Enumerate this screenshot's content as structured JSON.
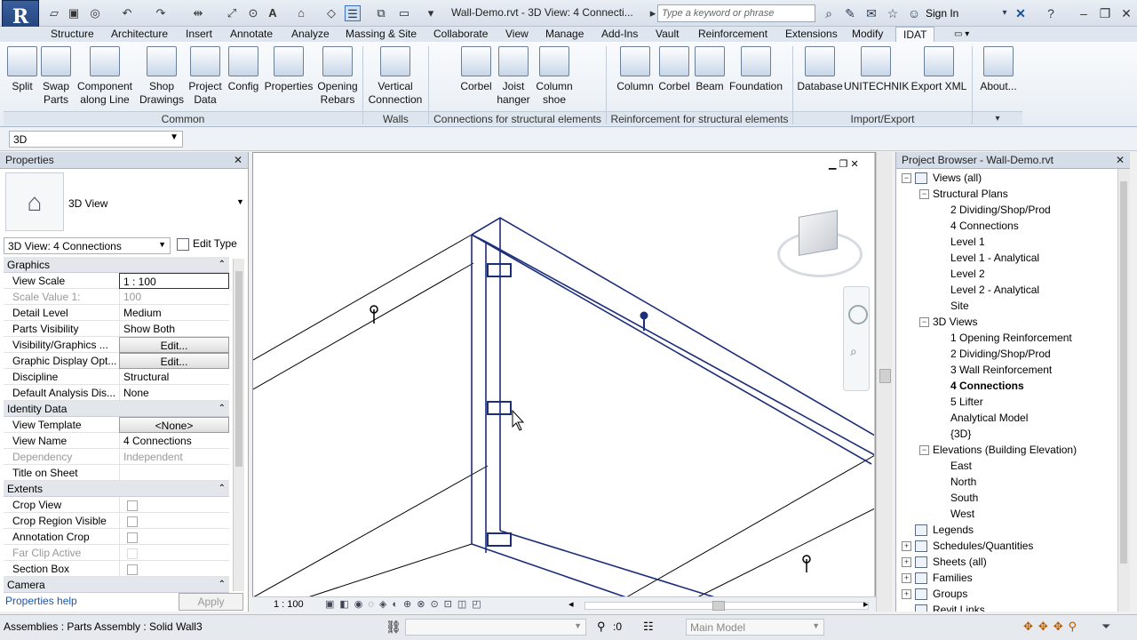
{
  "titlebar": {
    "app_logo": "R",
    "document_title": "Wall-Demo.rvt - 3D View: 4 Connecti...",
    "search_placeholder": "Type a keyword or phrase",
    "sign_in": "Sign In"
  },
  "ribbon": {
    "tabs": [
      "Structure",
      "Architecture",
      "Insert",
      "Annotate",
      "Analyze",
      "Massing & Site",
      "Collaborate",
      "View",
      "Manage",
      "Add-Ins",
      "Vault",
      "Reinforcement",
      "Extensions",
      "Modify",
      "IDAT"
    ],
    "active_tab": "IDAT",
    "buttons": {
      "split": "Split",
      "swap_parts": "Swap Parts",
      "component_along_line": "Component along Line",
      "shop_drawings": "Shop Drawings",
      "project_data": "Project Data",
      "config": "Config",
      "properties": "Properties",
      "opening_rebars": "Opening Rebars",
      "vertical_connection": "Vertical Connection",
      "corbel": "Corbel",
      "joist_hanger": "Joist hanger",
      "column_shoe": "Column shoe",
      "column": "Column",
      "corbel2": "Corbel",
      "beam": "Beam",
      "foundation": "Foundation",
      "database": "Database",
      "unitechnik": "UNITECHNIK",
      "export_xml": "Export XML",
      "about": "About..."
    },
    "panels": {
      "common": "Common",
      "walls": "Walls",
      "connections": "Connections for structural elements",
      "reinforcement": "Reinforcement for structural elements",
      "import_export": "Import/Export"
    }
  },
  "typebar": {
    "value": "3D"
  },
  "properties": {
    "title": "Properties",
    "type_name": "3D View",
    "instance_selector": "3D View: 4 Connections",
    "edit_type": "Edit Type",
    "groups": {
      "graphics": "Graphics",
      "identity": "Identity Data",
      "extents": "Extents",
      "camera": "Camera"
    },
    "rows": {
      "view_scale_k": "View Scale",
      "view_scale_v": "1 : 100",
      "scale_value_k": "Scale Value    1:",
      "scale_value_v": "100",
      "detail_level_k": "Detail Level",
      "detail_level_v": "Medium",
      "parts_visibility_k": "Parts Visibility",
      "parts_visibility_v": "Show Both",
      "vis_graphics_k": "Visibility/Graphics ...",
      "vis_graphics_v": "Edit...",
      "graphic_display_k": "Graphic Display Opt...",
      "graphic_display_v": "Edit...",
      "discipline_k": "Discipline",
      "discipline_v": "Structural",
      "default_analysis_k": "Default Analysis Dis...",
      "default_analysis_v": "None",
      "view_template_k": "View Template",
      "view_template_v": "<None>",
      "view_name_k": "View Name",
      "view_name_v": "4 Connections",
      "dependency_k": "Dependency",
      "dependency_v": "Independent",
      "title_on_sheet_k": "Title on Sheet",
      "title_on_sheet_v": "",
      "crop_view_k": "Crop View",
      "crop_region_k": "Crop Region Visible",
      "annotation_crop_k": "Annotation Crop",
      "far_clip_k": "Far Clip Active",
      "section_box_k": "Section Box"
    },
    "help_link": "Properties help",
    "apply": "Apply"
  },
  "canvas": {
    "scale_label": "1 : 100"
  },
  "browser": {
    "title": "Project Browser - Wall-Demo.rvt",
    "nodes": [
      {
        "label": "Views (all)",
        "level": 0,
        "twisty": "−",
        "icon": true
      },
      {
        "label": "Structural Plans",
        "level": 1,
        "twisty": "−"
      },
      {
        "label": "2 Dividing/Shop/Prod",
        "level": 2
      },
      {
        "label": "4 Connections",
        "level": 2
      },
      {
        "label": "Level 1",
        "level": 2
      },
      {
        "label": "Level 1 - Analytical",
        "level": 2
      },
      {
        "label": "Level 2",
        "level": 2
      },
      {
        "label": "Level 2 - Analytical",
        "level": 2
      },
      {
        "label": "Site",
        "level": 2
      },
      {
        "label": "3D Views",
        "level": 1,
        "twisty": "−"
      },
      {
        "label": "1 Opening Reinforcement",
        "level": 2
      },
      {
        "label": "2 Dividing/Shop/Prod",
        "level": 2
      },
      {
        "label": "3 Wall Reinforcement",
        "level": 2
      },
      {
        "label": "4 Connections",
        "level": 2,
        "bold": true
      },
      {
        "label": "5 Lifter",
        "level": 2
      },
      {
        "label": "Analytical Model",
        "level": 2
      },
      {
        "label": "{3D}",
        "level": 2
      },
      {
        "label": "Elevations (Building Elevation)",
        "level": 1,
        "twisty": "−"
      },
      {
        "label": "East",
        "level": 2
      },
      {
        "label": "North",
        "level": 2
      },
      {
        "label": "South",
        "level": 2
      },
      {
        "label": "West",
        "level": 2
      },
      {
        "label": "Legends",
        "level": 0,
        "icon": true
      },
      {
        "label": "Schedules/Quantities",
        "level": 0,
        "twisty": "+",
        "icon": true
      },
      {
        "label": "Sheets (all)",
        "level": 0,
        "twisty": "+",
        "icon": true
      },
      {
        "label": "Families",
        "level": 0,
        "twisty": "+",
        "icon": true
      },
      {
        "label": "Groups",
        "level": 0,
        "twisty": "+",
        "icon": true
      },
      {
        "label": "Revit Links",
        "level": 0,
        "icon": true
      }
    ]
  },
  "statusbar": {
    "message": "Assemblies : Parts Assembly : Solid Wall3",
    "selection_count": ":0",
    "model": "Main Model"
  }
}
